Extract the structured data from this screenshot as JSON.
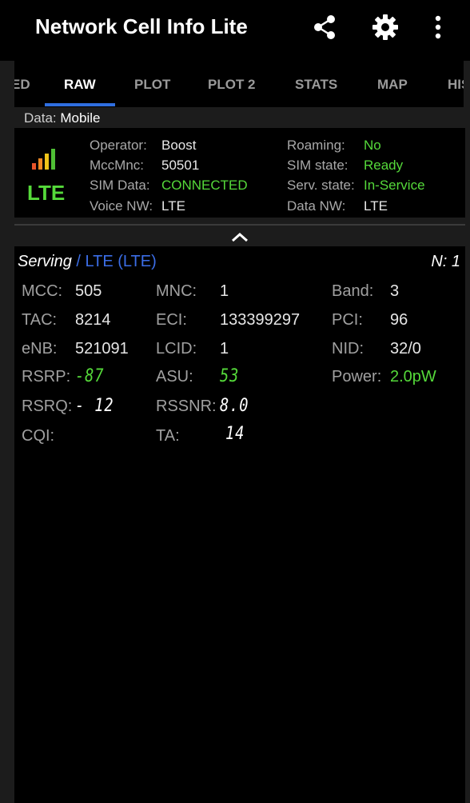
{
  "app": {
    "title": "Network Cell Info Lite",
    "icons": [
      "share-icon",
      "gear-icon",
      "more-vert-icon"
    ]
  },
  "tabs": [
    {
      "label": "ED"
    },
    {
      "label": "RAW",
      "active": true
    },
    {
      "label": "PLOT"
    },
    {
      "label": "PLOT 2"
    },
    {
      "label": "STATS"
    },
    {
      "label": "MAP"
    },
    {
      "label": "HIS"
    }
  ],
  "data_row": {
    "label": "Data:",
    "value": "Mobile"
  },
  "network": {
    "tech": "LTE",
    "signal_bars_lit": 4,
    "operator_label": "Operator:",
    "operator": "Boost",
    "mccmnc_label": "MccMnc:",
    "mccmnc": "50501",
    "simdata_label": "SIM Data:",
    "simdata": "CONNECTED",
    "voicenw_label": "Voice NW:",
    "voicenw": "LTE",
    "roaming_label": "Roaming:",
    "roaming": "No",
    "simstate_label": "SIM state:",
    "simstate": "Ready",
    "servstate_label": "Serv. state:",
    "servstate": "In-Service",
    "datanw_label": "Data NW:",
    "datanw": "LTE"
  },
  "serving": {
    "label": "Serving",
    "tech": " / LTE (LTE)",
    "n": "N: 1",
    "mcc_label": "MCC:",
    "mcc": "505",
    "mnc_label": "MNC:",
    "mnc": "1",
    "band_label": "Band:",
    "band": "3",
    "tac_label": "TAC:",
    "tac": "8214",
    "eci_label": "ECI:",
    "eci": "133399297",
    "pci_label": "PCI:",
    "pci": "96",
    "enb_label": "eNB:",
    "enb": "521091",
    "lcid_label": "LCID:",
    "lcid": "1",
    "nid_label": "NID:",
    "nid": "32/0",
    "rsrp_label": "RSRP:",
    "rsrp": "-87",
    "asu_label": "ASU:",
    "asu": "53",
    "power_label": "Power:",
    "power": "2.0pW",
    "rsrq_label": "RSRQ:",
    "rsrq": "- 12",
    "rssnr_label": "RSSNR:",
    "rssnr": "8.0",
    "cqi_label": "CQI:",
    "cqi": "",
    "ta_label": "TA:",
    "ta": "14"
  },
  "colors": {
    "accent": "#2f6fe0",
    "good": "#55d93a",
    "tech": "#3b6de6"
  }
}
